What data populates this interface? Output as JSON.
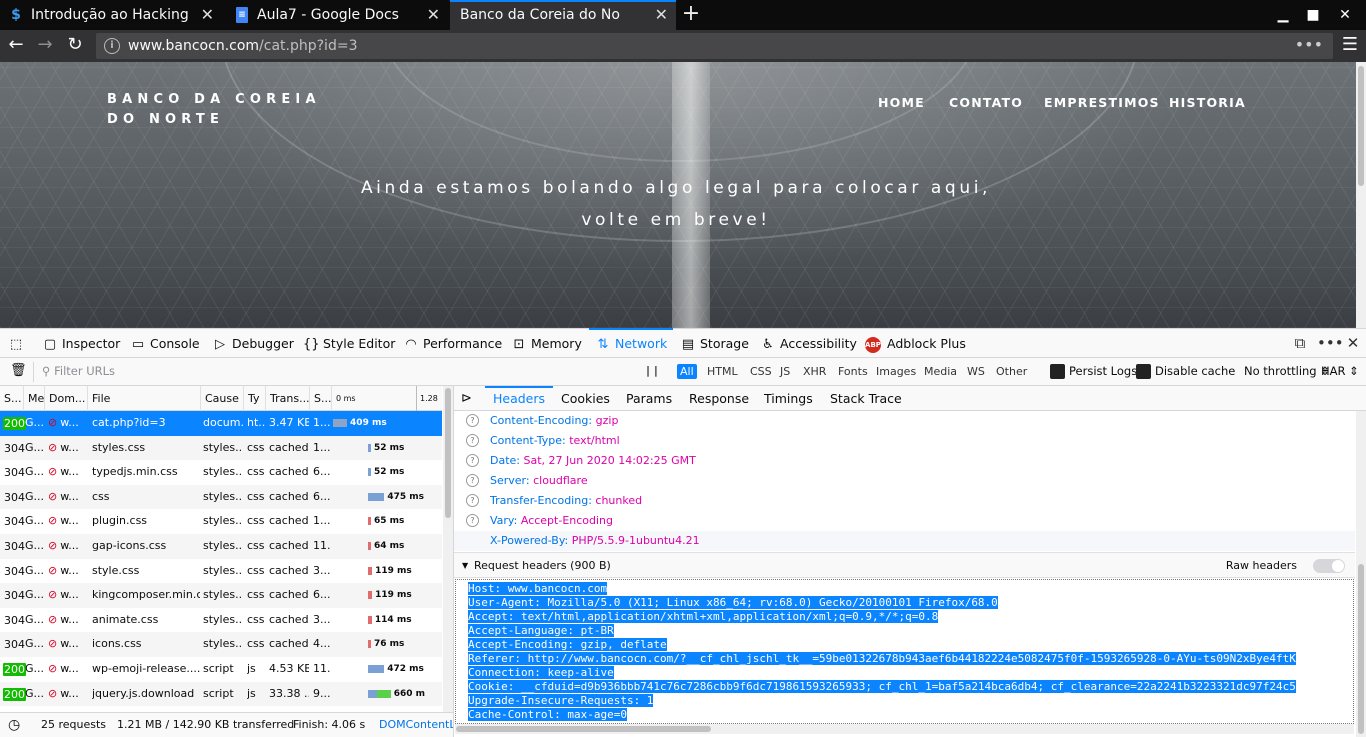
{
  "tabs": [
    {
      "title": "Introdução ao Hacking e P",
      "icon": "dollar-s-favicon"
    },
    {
      "title": "Aula7 - Google Docs",
      "icon": "docs-favicon"
    },
    {
      "title": "Banco da Coreia do Norte",
      "icon": ""
    }
  ],
  "url": {
    "domain": "www.bancocn.com",
    "path": "/cat.php?id=3"
  },
  "site": {
    "logo": "BANCO DA COREIA DO NORTE",
    "menu": [
      "HOME",
      "CONTATO",
      "EMPRESTIMOS",
      "HISTORIA"
    ],
    "hero_line1": "Ainda estamos bolando algo legal para colocar aqui,",
    "hero_line2": "volte em breve!"
  },
  "devtools": {
    "tabs": [
      "Inspector",
      "Console",
      "Debugger",
      "Style Editor",
      "Performance",
      "Memory",
      "Network",
      "Storage",
      "Accessibility",
      "Adblock Plus"
    ],
    "selected_tab": "Network",
    "filter_placeholder": "Filter URLs",
    "type_filters": [
      "All",
      "HTML",
      "CSS",
      "JS",
      "XHR",
      "Fonts",
      "Images",
      "Media",
      "WS",
      "Other"
    ],
    "persist_logs": "Persist Logs",
    "disable_cache": "Disable cache",
    "throttling": "No throttling ⇕",
    "har": "HAR ⇕"
  },
  "columns": [
    "S...",
    "Me",
    "Dom...",
    "File",
    "Cause",
    "Ty",
    "Trans...",
    "S...",
    "0 ms",
    "1.28 s"
  ],
  "requests": [
    {
      "status": "200",
      "method": "G...",
      "domain": "w...",
      "file": "cat.php?id=3",
      "cause": "docum...",
      "type": "ht...",
      "transferred": "3.47 KB",
      "size": "1...",
      "time": "409 ms",
      "bar_start": 0,
      "bar_ms": 409,
      "color": "#8fa4c4"
    },
    {
      "status": "304",
      "method": "G...",
      "domain": "w...",
      "file": "styles.css",
      "cause": "styles...",
      "type": "css",
      "transferred": "cached",
      "size": "1...",
      "time": "52 ms",
      "bar_start": 430,
      "bar_ms": 52,
      "color": "#7aa0d4"
    },
    {
      "status": "304",
      "method": "G...",
      "domain": "w...",
      "file": "typedjs.min.css",
      "cause": "styles...",
      "type": "css",
      "transferred": "cached",
      "size": "6...",
      "time": "52 ms",
      "bar_start": 430,
      "bar_ms": 52,
      "color": "#7aa0d4"
    },
    {
      "status": "304",
      "method": "G...",
      "domain": "w...",
      "file": "css",
      "cause": "styles...",
      "type": "css",
      "transferred": "cached",
      "size": "6...",
      "time": "475 ms",
      "bar_start": 430,
      "bar_ms": 475,
      "color": "#7aa0d4"
    },
    {
      "status": "304",
      "method": "G...",
      "domain": "w...",
      "file": "plugin.css",
      "cause": "styles...",
      "type": "css",
      "transferred": "cached",
      "size": "1...",
      "time": "65 ms",
      "bar_start": 440,
      "bar_ms": 65,
      "color": "#e06c6c"
    },
    {
      "status": "304",
      "method": "G...",
      "domain": "w...",
      "file": "gap-icons.css",
      "cause": "styles...",
      "type": "css",
      "transferred": "cached",
      "size": "11...",
      "time": "64 ms",
      "bar_start": 440,
      "bar_ms": 64,
      "color": "#e06c6c"
    },
    {
      "status": "304",
      "method": "G...",
      "domain": "w...",
      "file": "style.css",
      "cause": "styles...",
      "type": "css",
      "transferred": "cached",
      "size": "3...",
      "time": "119 ms",
      "bar_start": 440,
      "bar_ms": 119,
      "color": "#e06c6c"
    },
    {
      "status": "304",
      "method": "G...",
      "domain": "w...",
      "file": "kingcomposer.min.c...",
      "cause": "styles...",
      "type": "css",
      "transferred": "cached",
      "size": "6...",
      "time": "119 ms",
      "bar_start": 440,
      "bar_ms": 119,
      "color": "#e06c6c"
    },
    {
      "status": "304",
      "method": "G...",
      "domain": "w...",
      "file": "animate.css",
      "cause": "styles...",
      "type": "css",
      "transferred": "cached",
      "size": "3...",
      "time": "114 ms",
      "bar_start": 440,
      "bar_ms": 114,
      "color": "#e06c6c"
    },
    {
      "status": "304",
      "method": "G...",
      "domain": "w...",
      "file": "icons.css",
      "cause": "styles...",
      "type": "css",
      "transferred": "cached",
      "size": "4...",
      "time": "76 ms",
      "bar_start": 440,
      "bar_ms": 76,
      "color": "#e06c6c"
    },
    {
      "status": "200",
      "method": "G...",
      "domain": "w...",
      "file": "wp-emoji-release....",
      "cause": "script",
      "type": "js",
      "transferred": "4.53 KB",
      "size": "11...",
      "time": "472 ms",
      "bar_start": 430,
      "bar_ms": 472,
      "color": "#7aa0d4"
    },
    {
      "status": "200",
      "method": "G...",
      "domain": "w...",
      "file": "jquery.js.download",
      "cause": "script",
      "type": "js",
      "transferred": "33.38 ...",
      "size": "9...",
      "time": "660 m",
      "bar_start": 430,
      "bar_ms": 660,
      "color": "#7aa0d4"
    },
    {
      "status": "",
      "method": "",
      "domain": "",
      "file": "",
      "cause": "",
      "type": "",
      "transferred": "",
      "size": "",
      "time": "",
      "bar_start": 0,
      "bar_ms": 0,
      "color": "#ffffff"
    }
  ],
  "statusbar": {
    "requests": "25 requests",
    "transferred": "1.21 MB / 142.90 KB transferred",
    "finish": "Finish: 4.06 s",
    "dcl": "DOMContentL..."
  },
  "detail_tabs": [
    "Headers",
    "Cookies",
    "Params",
    "Response",
    "Timings",
    "Stack Trace"
  ],
  "response_headers": [
    {
      "name": "Content-Encoding:",
      "value": "gzip",
      "help": true
    },
    {
      "name": "Content-Type:",
      "value": "text/html",
      "help": true
    },
    {
      "name": "Date:",
      "value": "Sat, 27 Jun 2020 14:02:25 GMT",
      "help": true
    },
    {
      "name": "Server:",
      "value": "cloudflare",
      "help": true
    },
    {
      "name": "Transfer-Encoding:",
      "value": "chunked",
      "help": true
    },
    {
      "name": "Vary:",
      "value": "Accept-Encoding",
      "help": true
    },
    {
      "name": "X-Powered-By:",
      "value": "PHP/5.5.9-1ubuntu4.21",
      "help": false
    }
  ],
  "request_headers_title": "Request headers (900 B)",
  "raw_headers_label": "Raw headers",
  "raw_headers": [
    "Host: www.bancocn.com",
    "User-Agent: Mozilla/5.0 (X11; Linux x86_64; rv:68.0) Gecko/20100101 Firefox/68.0",
    "Accept: text/html,application/xhtml+xml,application/xml;q=0.9,*/*;q=0.8",
    "Accept-Language: pt-BR",
    "Accept-Encoding: gzip, deflate",
    "Referer: http://www.bancocn.com/?__cf_chl_jschl_tk__=59be01322678b943aef6b44182224e5082475f0f-1593265928-0-AYu-ts09N2xBye4ftK",
    "Connection: keep-alive",
    "Cookie: __cfduid=d9b936bbb741c76c7286cbb9f6dc719861593265933; cf_chl_1=baf5a214bca6db4; cf_clearance=22a2241b3223321dc97f24c5",
    "Upgrade-Insecure-Requests: 1",
    "Cache-Control: max-age=0"
  ],
  "colors": {
    "accent": "#0a84ff",
    "ok": "#12bc00",
    "header_name": "#0074e8",
    "header_value": "#dd00a9"
  }
}
